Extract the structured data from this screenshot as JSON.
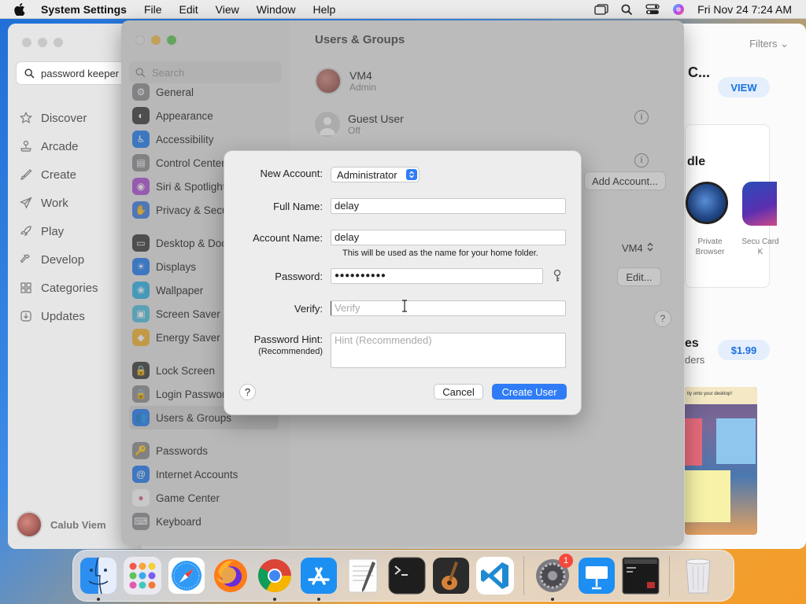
{
  "menubar": {
    "app_name": "System Settings",
    "items": [
      "File",
      "Edit",
      "View",
      "Window",
      "Help"
    ],
    "clock": "Fri Nov 24  7:24 AM"
  },
  "appstore": {
    "search_value": "password keeper",
    "nav": [
      {
        "label": "Discover",
        "icon": "star-icon"
      },
      {
        "label": "Arcade",
        "icon": "joystick-icon"
      },
      {
        "label": "Create",
        "icon": "brush-icon"
      },
      {
        "label": "Work",
        "icon": "paper-plane-icon"
      },
      {
        "label": "Play",
        "icon": "rocket-icon"
      },
      {
        "label": "Develop",
        "icon": "hammer-icon"
      },
      {
        "label": "Categories",
        "icon": "grid-icon"
      },
      {
        "label": "Updates",
        "icon": "download-icon"
      }
    ],
    "user_name": "Calub Viem",
    "filters_label": "Filters",
    "heading_c": "C...",
    "view_button": "VIEW",
    "bundle_heading": "dle",
    "app1_label": "Private Browser",
    "app2_label": "Secu Card K",
    "section_heading": "es",
    "section_sub": "ders",
    "price": "$1.99",
    "shot_banner": "tly onto your desktop!"
  },
  "settings": {
    "title": "Users & Groups",
    "search_placeholder": "Search",
    "sidebar": [
      {
        "label": "General",
        "color": "#8e8e93",
        "glyph": "⚙"
      },
      {
        "label": "Appearance",
        "color": "#3a3a3c",
        "glyph": "◐"
      },
      {
        "label": "Accessibility",
        "color": "#1f7cf2",
        "glyph": "♿"
      },
      {
        "label": "Control Center",
        "color": "#8e8e93",
        "glyph": "▤"
      },
      {
        "label": "Siri & Spotlight",
        "color": "#b04fd6",
        "glyph": "◉"
      },
      {
        "label": "Privacy & Security",
        "color": "#3d7de6",
        "glyph": "✋"
      },
      {
        "label": "Desktop & Dock",
        "color": "#3a3a3c",
        "glyph": "▭"
      },
      {
        "label": "Displays",
        "color": "#1f7cf2",
        "glyph": "☀"
      },
      {
        "label": "Wallpaper",
        "color": "#2fb3e8",
        "glyph": "❀"
      },
      {
        "label": "Screen Saver",
        "color": "#4fc1e0",
        "glyph": "▣"
      },
      {
        "label": "Energy Saver",
        "color": "#f5b32f",
        "glyph": "◆"
      },
      {
        "label": "Lock Screen",
        "color": "#3a3a3c",
        "glyph": "🔒"
      },
      {
        "label": "Login Password",
        "color": "#8e8e93",
        "glyph": "🔒"
      },
      {
        "label": "Users & Groups",
        "color": "#1f7cf2",
        "glyph": "👥"
      },
      {
        "label": "Passwords",
        "color": "#8e8e93",
        "glyph": "🔑"
      },
      {
        "label": "Internet Accounts",
        "color": "#1f7cf2",
        "glyph": "@"
      },
      {
        "label": "Game Center",
        "color": "#ffffff",
        "glyph": "●"
      },
      {
        "label": "Keyboard",
        "color": "#8e8e93",
        "glyph": "⌨"
      }
    ],
    "users": [
      {
        "name": "VM4",
        "role": "Admin"
      },
      {
        "name": "Guest User",
        "role": "Off"
      }
    ],
    "add_account": "Add Account...",
    "vm4_select": "VM4",
    "edit_button": "Edit...",
    "help": "?"
  },
  "dialog": {
    "new_account_label": "New Account:",
    "new_account_value": "Administrator",
    "full_name_label": "Full Name:",
    "full_name_value": "delay",
    "account_name_label": "Account Name:",
    "account_name_value": "delay",
    "account_note": "This will be used as the name for your home folder.",
    "password_label": "Password:",
    "password_value": "●●●●●●●●●●",
    "verify_label": "Verify:",
    "verify_placeholder": "Verify",
    "hint_label": "Password Hint:",
    "hint_sublabel": "(Recommended)",
    "hint_placeholder": "Hint (Recommended)",
    "help": "?",
    "cancel": "Cancel",
    "create": "Create User"
  },
  "dock": {
    "items": [
      {
        "name": "finder-icon",
        "running": true
      },
      {
        "name": "launchpad-icon",
        "running": false
      },
      {
        "name": "safari-icon",
        "running": false
      },
      {
        "name": "firefox-icon",
        "running": false
      },
      {
        "name": "chrome-icon",
        "running": true
      },
      {
        "name": "app-store-icon",
        "running": true
      },
      {
        "name": "textedit-icon",
        "running": false
      },
      {
        "name": "terminal-icon",
        "running": false
      },
      {
        "name": "garageband-icon",
        "running": false
      },
      {
        "name": "vscode-icon",
        "running": false
      }
    ],
    "settings_badge": "1"
  }
}
